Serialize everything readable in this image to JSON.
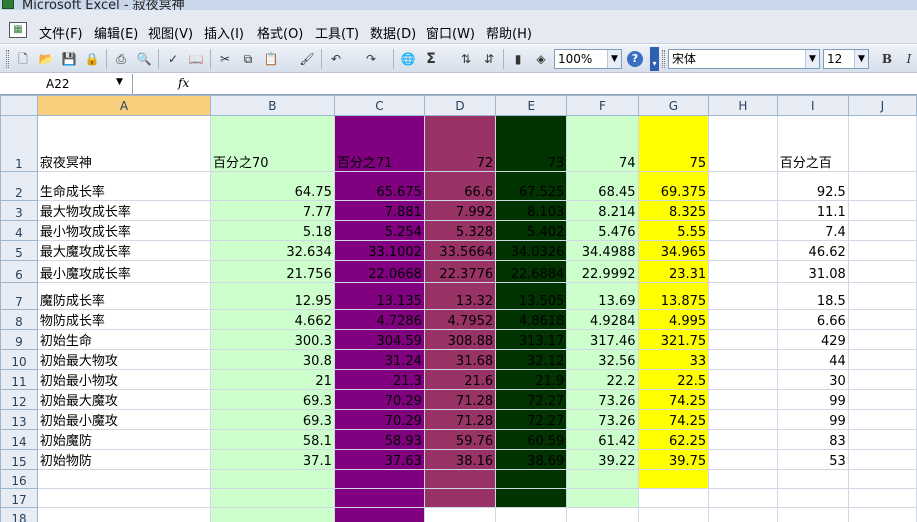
{
  "window": {
    "title": "Microsoft Excel - 寂夜冥神"
  },
  "menu": {
    "app_icon": "[图]",
    "items": [
      "文件(F)",
      "编辑(E)",
      "视图(V)",
      "插入(I)",
      "格式(O)",
      "工具(T)",
      "数据(D)",
      "窗口(W)",
      "帮助(H)"
    ]
  },
  "toolbar": {
    "zoom": "100%",
    "font_name": "宋体",
    "font_size": "12",
    "bold_label": "B",
    "italic_label": "I",
    "sum_label": "Σ",
    "buttons": [
      "new-icon",
      "open-icon",
      "save-icon",
      "permission-icon",
      "print-icon",
      "print-preview-icon",
      "spelling-icon",
      "research-icon",
      "cut-icon",
      "copy-icon",
      "paste-icon",
      "format-painter-icon",
      "undo-icon",
      "redo-icon",
      "hyperlink-icon",
      "autosum-icon",
      "sort-ascending-icon",
      "sort-descending-icon",
      "chart-wizard-icon",
      "drawing-icon",
      "help-icon"
    ]
  },
  "formula_bar": {
    "name_box": "A22",
    "fx": "fx",
    "value": ""
  },
  "sheet": {
    "columns": [
      "A",
      "B",
      "C",
      "D",
      "E",
      "F",
      "G",
      "H",
      "I",
      "J"
    ],
    "selected_column": "A",
    "colors": {
      "B": "#ccffcc",
      "C": "#800080",
      "D": "#993366",
      "E": "#003300",
      "F": "#ccffcc",
      "G": "#ffff00"
    },
    "rows": [
      {
        "num": "1",
        "cells": [
          "寂夜冥神",
          "百分之70",
          "百分之71",
          "72",
          "73",
          "74",
          "75",
          "",
          "百分之百",
          ""
        ]
      },
      {
        "num": "2",
        "cells": [
          "生命成长率",
          "64.75",
          "65.675",
          "66.6",
          "67.525",
          "68.45",
          "69.375",
          "",
          "92.5",
          ""
        ]
      },
      {
        "num": "3",
        "cells": [
          "最大物攻成长率",
          "7.77",
          "7.881",
          "7.992",
          "8.103",
          "8.214",
          "8.325",
          "",
          "11.1",
          ""
        ]
      },
      {
        "num": "4",
        "cells": [
          "最小物攻成长率",
          "5.18",
          "5.254",
          "5.328",
          "5.402",
          "5.476",
          "5.55",
          "",
          "7.4",
          ""
        ]
      },
      {
        "num": "5",
        "cells": [
          "最大魔攻成长率",
          "32.634",
          "33.1002",
          "33.5664",
          "34.0326",
          "34.4988",
          "34.965",
          "",
          "46.62",
          ""
        ]
      },
      {
        "num": "6",
        "cells": [
          "最小魔攻成长率",
          "21.756",
          "22.0668",
          "22.3776",
          "22.6884",
          "22.9992",
          "23.31",
          "",
          "31.08",
          ""
        ]
      },
      {
        "num": "7",
        "cells": [
          "魔防成长率",
          "12.95",
          "13.135",
          "13.32",
          "13.505",
          "13.69",
          "13.875",
          "",
          "18.5",
          ""
        ]
      },
      {
        "num": "8",
        "cells": [
          "物防成长率",
          "4.662",
          "4.7286",
          "4.7952",
          "4.8618",
          "4.9284",
          "4.995",
          "",
          "6.66",
          ""
        ]
      },
      {
        "num": "9",
        "cells": [
          "初始生命",
          "300.3",
          "304.59",
          "308.88",
          "313.17",
          "317.46",
          "321.75",
          "",
          "429",
          ""
        ]
      },
      {
        "num": "10",
        "cells": [
          "初始最大物攻",
          "30.8",
          "31.24",
          "31.68",
          "32.12",
          "32.56",
          "33",
          "",
          "44",
          ""
        ]
      },
      {
        "num": "11",
        "cells": [
          "初始最小物攻",
          "21",
          "21.3",
          "21.6",
          "21.9",
          "22.2",
          "22.5",
          "",
          "30",
          ""
        ]
      },
      {
        "num": "12",
        "cells": [
          "初始最大魔攻",
          "69.3",
          "70.29",
          "71.28",
          "72.27",
          "73.26",
          "74.25",
          "",
          "99",
          ""
        ]
      },
      {
        "num": "13",
        "cells": [
          "初始最小魔攻",
          "69.3",
          "70.29",
          "71.28",
          "72.27",
          "73.26",
          "74.25",
          "",
          "99",
          ""
        ]
      },
      {
        "num": "14",
        "cells": [
          "初始魔防",
          "58.1",
          "58.93",
          "59.76",
          "60.59",
          "61.42",
          "62.25",
          "",
          "83",
          ""
        ]
      },
      {
        "num": "15",
        "cells": [
          "初始物防",
          "37.1",
          "37.63",
          "38.16",
          "38.69",
          "39.22",
          "39.75",
          "",
          "53",
          ""
        ]
      },
      {
        "num": "16",
        "cells": [
          "",
          "",
          "",
          "",
          "",
          "",
          "",
          "",
          "",
          ""
        ]
      },
      {
        "num": "17",
        "cells": [
          "",
          "",
          "",
          "",
          "",
          "",
          "",
          "",
          "",
          ""
        ]
      },
      {
        "num": "18",
        "cells": [
          "",
          "",
          "",
          "",
          "",
          "",
          "",
          "",
          "",
          ""
        ]
      }
    ]
  }
}
